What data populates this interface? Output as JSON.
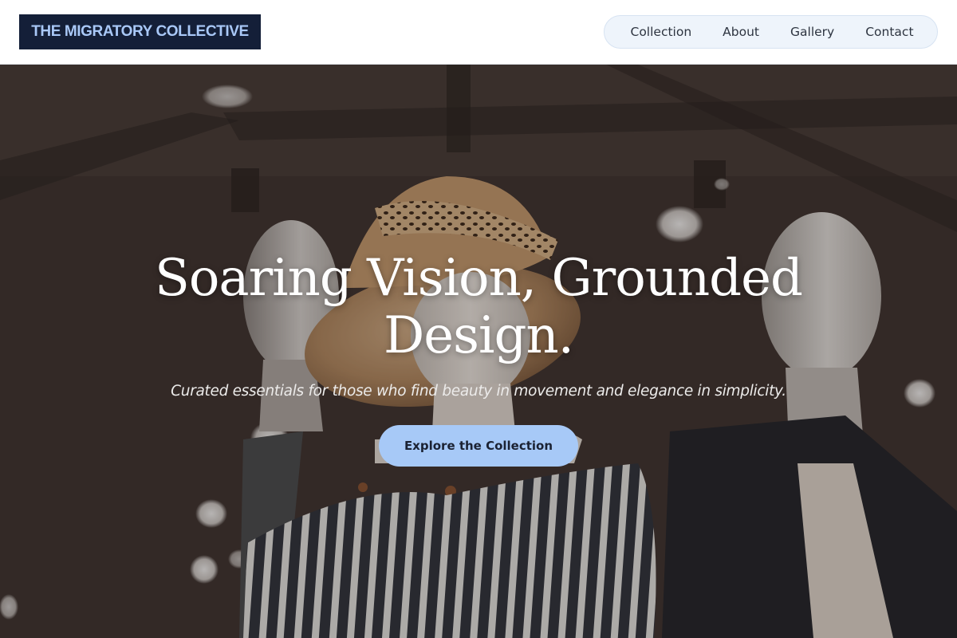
{
  "brand": {
    "name": "THE MIGRATORY COLLECTIVE"
  },
  "nav": {
    "items": [
      {
        "label": "Collection"
      },
      {
        "label": "About"
      },
      {
        "label": "Gallery"
      },
      {
        "label": "Contact"
      }
    ]
  },
  "hero": {
    "title_line1": "Soaring Vision, Grounded",
    "title_line2": "Design.",
    "subtitle": "Curated essentials for those who find beauty in movement and elegance in simplicity.",
    "cta_label": "Explore the Collection",
    "background": "photo of mannequins in a boutique: a straw hat with a leopard-print bow, striped off-shoulder top, wooden bead necklace and a dark blazer"
  },
  "colors": {
    "brand_bg": "#141f38",
    "brand_text": "#a9c8f7",
    "nav_bg": "#eef4fb",
    "nav_text": "#2d3440",
    "cta_bg": "#a7c9f7",
    "cta_text": "#1b2233",
    "hero_text": "#ffffff"
  }
}
